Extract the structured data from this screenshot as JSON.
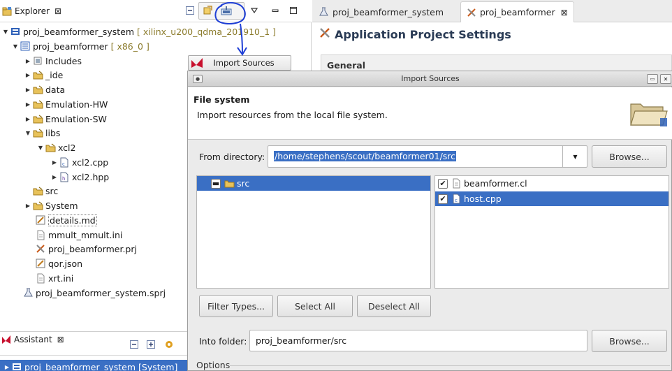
{
  "explorer": {
    "tab_label": "Explorer",
    "close_glyph": "⊠",
    "tools": [
      "collapse-all-icon",
      "link-editor-icon",
      "import-sources-icon",
      "view-menu-icon",
      "minimize-icon",
      "maximize-icon"
    ],
    "tree": [
      {
        "label": "proj_beamformer_system",
        "suffix": "[ xilinx_u200_qdma_201910_1 ]",
        "level": 0,
        "twisty": "open",
        "icon": "system-project-icon"
      },
      {
        "label": "proj_beamformer",
        "suffix": "[ x86_0 ]",
        "level": 1,
        "twisty": "open",
        "icon": "app-project-icon"
      },
      {
        "label": "Includes",
        "suffix": "",
        "level": 2,
        "twisty": "closed",
        "icon": "includes-icon"
      },
      {
        "label": "_ide",
        "suffix": "",
        "level": 2,
        "twisty": "closed",
        "icon": "folder-icon"
      },
      {
        "label": "data",
        "suffix": "",
        "level": 2,
        "twisty": "closed",
        "icon": "folder-icon"
      },
      {
        "label": "Emulation-HW",
        "suffix": "",
        "level": 2,
        "twisty": "closed",
        "icon": "folder-icon"
      },
      {
        "label": "Emulation-SW",
        "suffix": "",
        "level": 2,
        "twisty": "closed",
        "icon": "folder-icon"
      },
      {
        "label": "libs",
        "suffix": "",
        "level": 2,
        "twisty": "open",
        "icon": "folder-icon"
      },
      {
        "label": "xcl2",
        "suffix": "",
        "level": 3,
        "twisty": "open",
        "icon": "folder-icon"
      },
      {
        "label": "xcl2.cpp",
        "suffix": "",
        "level": 4,
        "twisty": "closed",
        "icon": "cpp-file-icon"
      },
      {
        "label": "xcl2.hpp",
        "suffix": "",
        "level": 4,
        "twisty": "closed",
        "icon": "header-file-icon"
      },
      {
        "label": "src",
        "suffix": "",
        "level": 2,
        "twisty": "none",
        "icon": "folder-icon"
      },
      {
        "label": "System",
        "suffix": "",
        "level": 2,
        "twisty": "closed",
        "icon": "folder-icon"
      },
      {
        "label": "details.md",
        "suffix": "",
        "level": 2,
        "twisty": "none",
        "icon": "markdown-file-icon"
      },
      {
        "label": "mmult_mmult.ini",
        "suffix": "",
        "level": 2,
        "twisty": "none",
        "icon": "text-file-icon"
      },
      {
        "label": "proj_beamformer.prj",
        "suffix": "",
        "level": 2,
        "twisty": "none",
        "icon": "project-settings-icon"
      },
      {
        "label": "qor.json",
        "suffix": "",
        "level": 2,
        "twisty": "none",
        "icon": "markdown-file-icon"
      },
      {
        "label": "xrt.ini",
        "suffix": "",
        "level": 2,
        "twisty": "none",
        "icon": "text-file-icon"
      },
      {
        "label": "proj_beamformer_system.sprj",
        "suffix": "",
        "level": 1,
        "twisty": "none",
        "icon": "flask-icon"
      }
    ]
  },
  "assistant": {
    "tab_label": "Assistant",
    "close_glyph": "⊠",
    "selected_row": "proj_beamformer_system [System]"
  },
  "editor": {
    "tabs": [
      {
        "label": "proj_beamformer_system",
        "active": false
      },
      {
        "label": "proj_beamformer",
        "active": true,
        "close_glyph": "⊠"
      }
    ],
    "page_title": "Application Project Settings",
    "section_label": "General"
  },
  "import_sources_button": {
    "label": "Import Sources"
  },
  "dialog": {
    "title": "Import Sources",
    "header_title": "File system",
    "header_desc": "Import resources from the local file system.",
    "from_directory_label": "From directory:",
    "from_directory_value": "/home/stephens/scout/beamformer01/src",
    "browse_label": "Browse...",
    "folder_tree": [
      {
        "label": "src",
        "selected": true
      }
    ],
    "files": [
      {
        "label": "beamformer.cl",
        "checked": true,
        "selected": false
      },
      {
        "label": "host.cpp",
        "checked": true,
        "selected": true
      }
    ],
    "filter_types_label": "Filter Types...",
    "select_all_label": "Select All",
    "deselect_all_label": "Deselect All",
    "into_folder_label": "Into folder:",
    "into_folder_value": "proj_beamformer/src",
    "browse2_label": "Browse...",
    "options_label": "Options"
  },
  "colors": {
    "selection": "#3a6fc4",
    "annotation": "#1f3fd6",
    "title_text": "#2a3b55"
  }
}
